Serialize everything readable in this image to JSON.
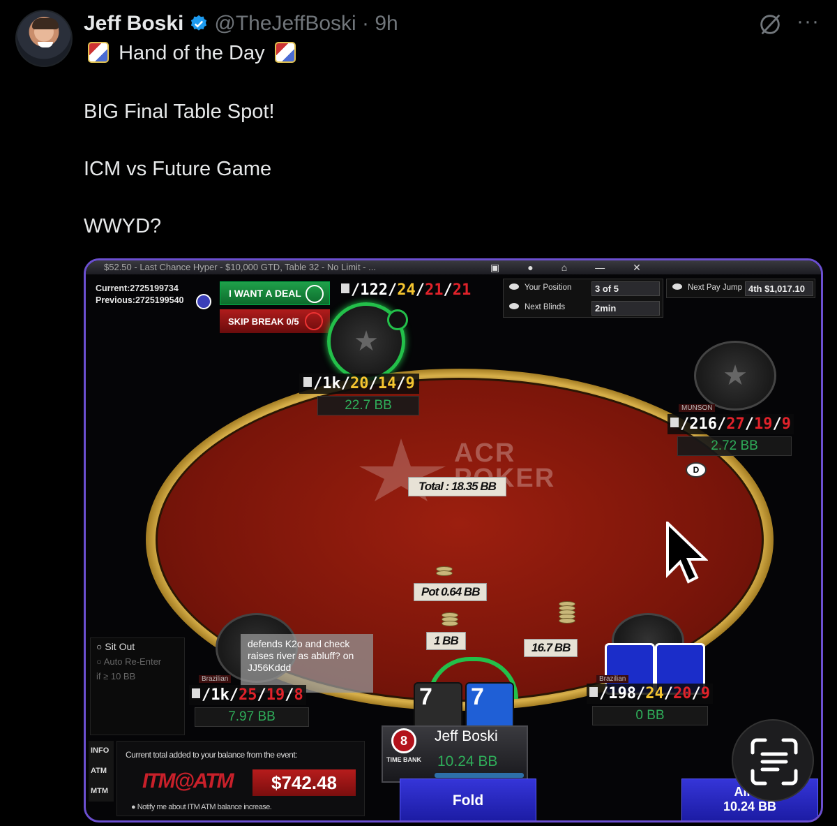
{
  "tweet": {
    "author_name": "Jeff Boski",
    "handle_time": "@TheJeffBoski · 9h",
    "line1": "Hand of the Day",
    "line2": "BIG Final Table Spot!",
    "line3": "ICM vs Future Game",
    "line4": "WWYD?",
    "more": "···"
  },
  "client": {
    "title": "$52.50 - Last Chance Hyper - $10,000 GTD, Table 32 - No Limit - ...",
    "current_id": "Current:2725199734",
    "previous_id": "Previous:2725199540",
    "deal_button": "I WANT A DEAL",
    "skip_break": "SKIP BREAK 0/5",
    "info": {
      "your_position_label": "Your Position",
      "your_position_value": "3 of 5",
      "next_blinds_label": "Next Blinds",
      "next_blinds_value": "2min",
      "next_pay_jump_label": "Next Pay Jump",
      "next_pay_jump_value": "4th $1,017.10"
    },
    "top_stats": {
      "a": "122",
      "b": "24",
      "c": "21",
      "d": "21"
    },
    "seat_top": {
      "stats": {
        "a": "1k",
        "b": "20",
        "c": "14",
        "d": "9"
      },
      "bb": "22.7 BB"
    },
    "seat_right": {
      "name": "MUNSON",
      "stats": {
        "a": "216",
        "b": "27",
        "c": "19",
        "d": "9"
      },
      "bb": "2.72 BB"
    },
    "seat_left": {
      "name": "Brazilian",
      "stats": {
        "a": "1k",
        "b": "25",
        "c": "19",
        "d": "8"
      },
      "bb": "7.97 BB"
    },
    "seat_bottom_right": {
      "name": "Brazilian",
      "stats": {
        "a": "198",
        "b": "24",
        "c": "20",
        "d": "9"
      },
      "bb": "0 BB"
    },
    "logo_line1": "ACR",
    "logo_line2": "POKER",
    "total": "Total : 18.35 BB",
    "pot": "Pot 0.64 BB",
    "bet_hero": "1 BB",
    "bet_right": "16.7 BB",
    "dealer": "D",
    "hero_cards": [
      "7",
      "7"
    ],
    "sit_out": "Sit Out",
    "auto_reenter": "Auto Re-Enter",
    "reenter_if": "if ≥   10   BB",
    "callout": "defends K2o and check raises river as abluff? on JJ56Kddd",
    "side_tabs": [
      "INFO",
      "ATM",
      "MTM"
    ],
    "itm_title": "Current total added to your balance from the event:",
    "itm_logo": "ITM@ATM",
    "itm_amount": "$742.48",
    "itm_note": "Notify me about ITM ATM balance increase.",
    "hero_name": "Jeff Boski",
    "hero_bb": "10.24 BB",
    "time_bank_value": "8",
    "time_bank_label": "TIME BANK",
    "fold": "Fold",
    "allin_label": "All-In",
    "allin_value": "10.24 BB"
  }
}
